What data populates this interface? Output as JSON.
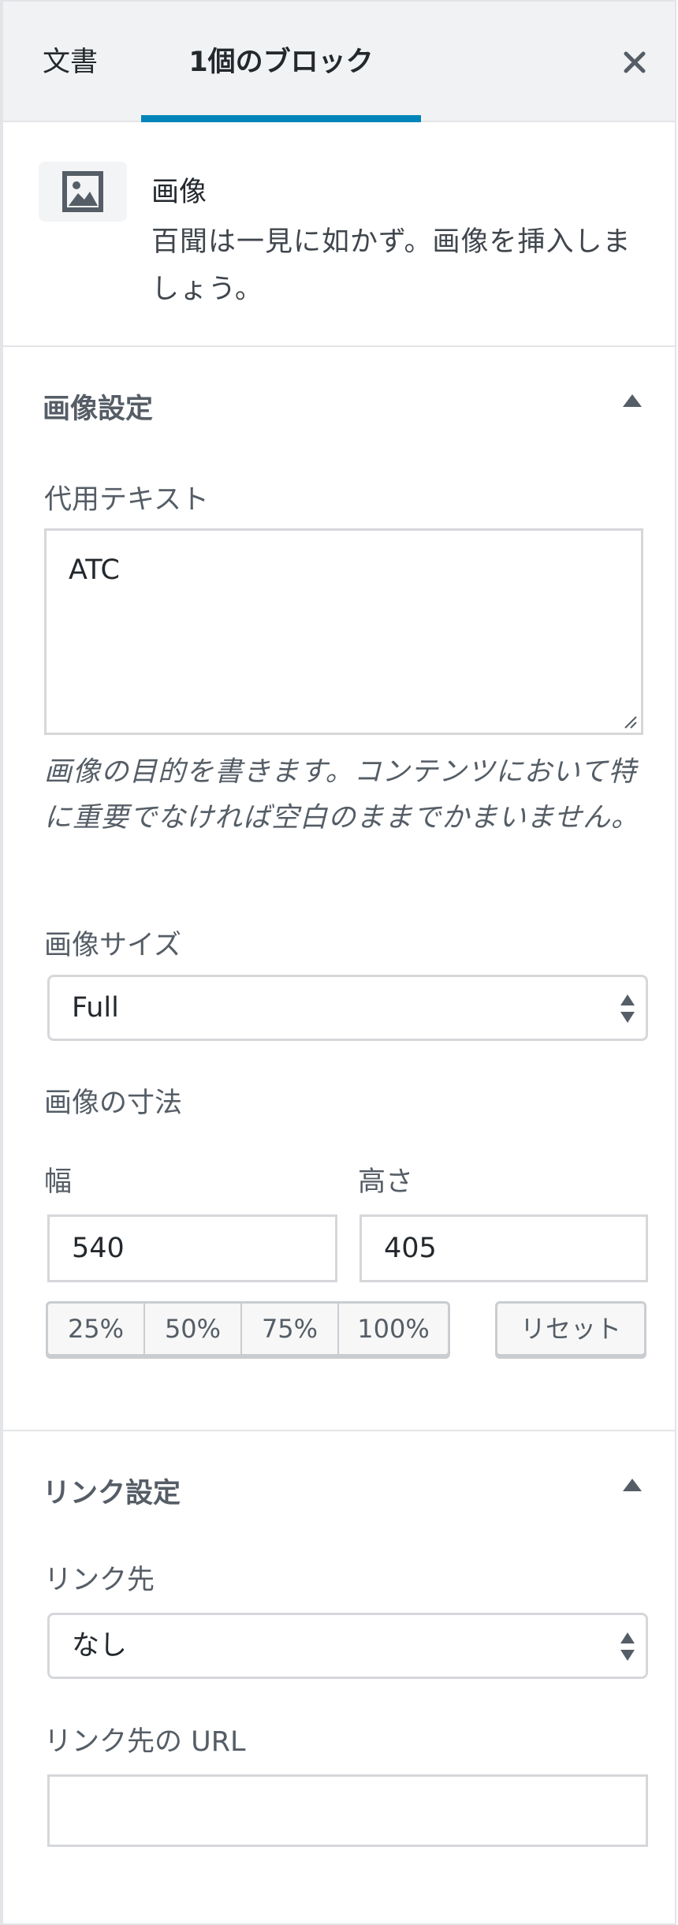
{
  "tabs": {
    "document": "文書",
    "block": "1個のブロック",
    "active": "block"
  },
  "icons": {
    "close": "close-icon",
    "image_block": "image-icon",
    "panel_toggle": "chevron-up-icon",
    "select_arrows": "select-arrows-icon"
  },
  "colors": {
    "accent": "#0085ba",
    "header_bg": "#f1f2f3",
    "border": "#e2e4e7"
  },
  "block_card": {
    "title": "画像",
    "description": "百聞は一見に如かず。画像を挿入しましょう。"
  },
  "image_settings": {
    "title": "画像設定",
    "alt_label": "代用テキスト",
    "alt_value": "ATC",
    "alt_help": "画像の目的を書きます。コンテンツにおいて特に重要でなければ空白のままでかまいません。",
    "size_label": "画像サイズ",
    "size_value": "Full",
    "dimensions_label": "画像の寸法",
    "width_label": "幅",
    "width_value": "540",
    "height_label": "高さ",
    "height_value": "405",
    "scale_buttons": [
      "25%",
      "50%",
      "75%",
      "100%"
    ],
    "reset_label": "リセット"
  },
  "link_settings": {
    "title": "リンク設定",
    "link_to_label": "リンク先",
    "link_to_value": "なし",
    "url_label": "リンク先の URL",
    "url_value": ""
  }
}
